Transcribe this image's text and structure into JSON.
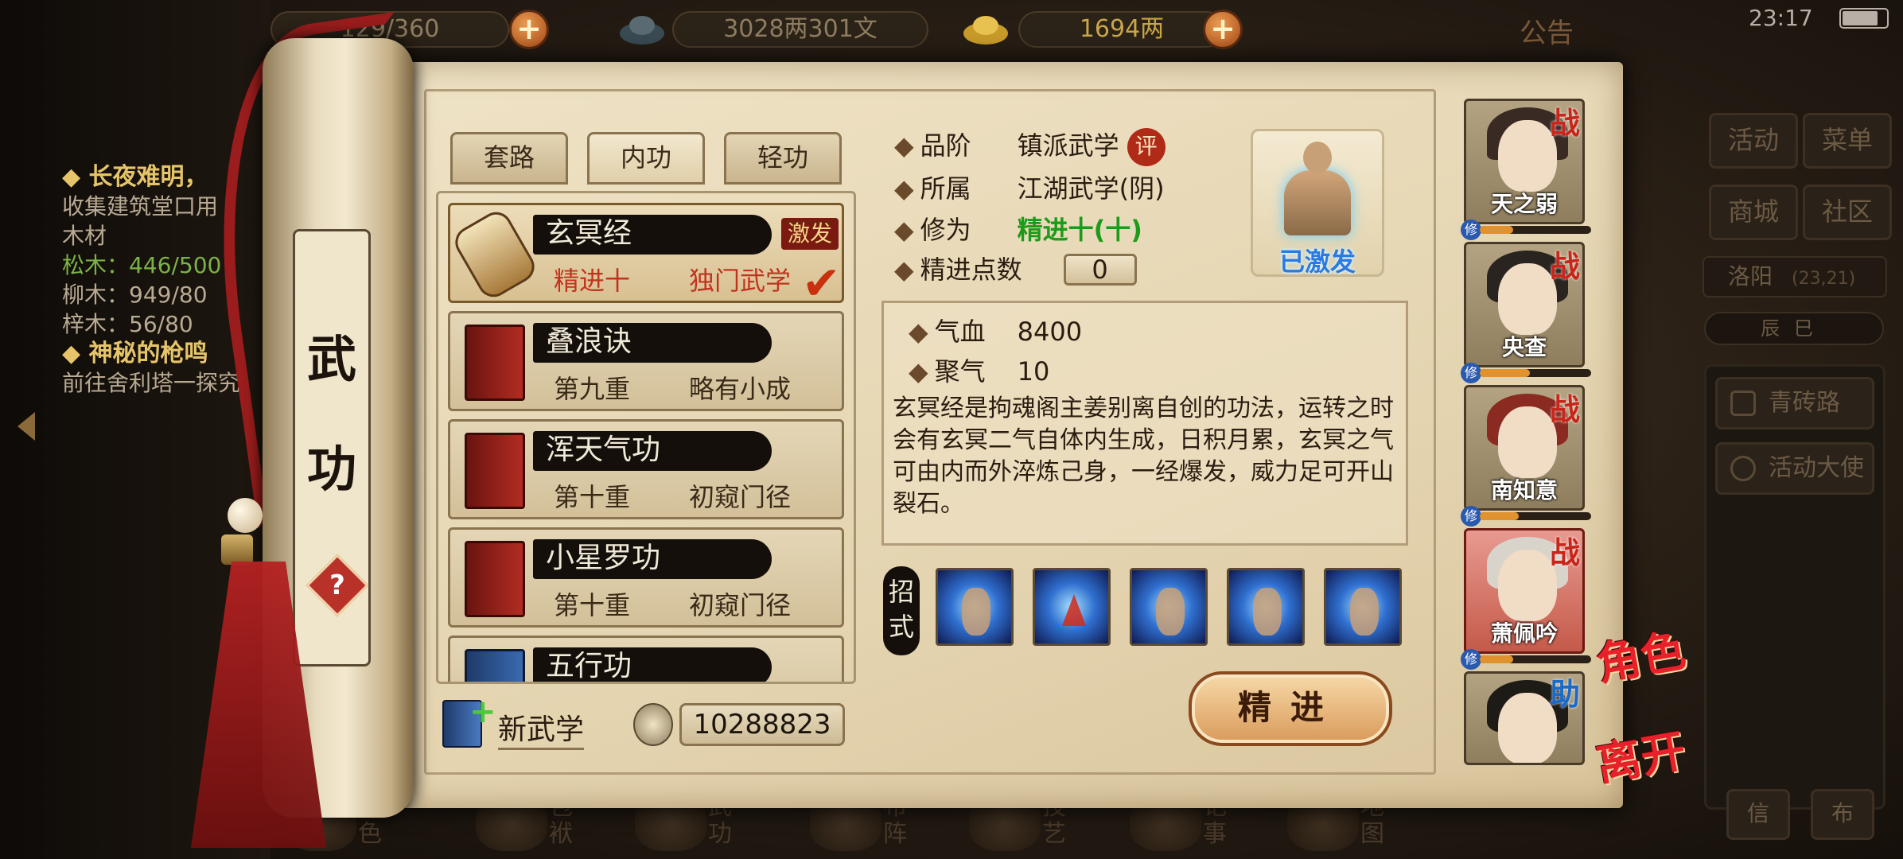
{
  "topbar": {
    "stamina": "129/360",
    "copper": "3028两301文",
    "gold": "1694两",
    "notice": "公告",
    "time": "23:17"
  },
  "quest": {
    "q1_title": "◆ 长夜难明，",
    "q1_desc": "收集建筑堂口用",
    "q1_sub": "木材",
    "mat1": "松木：446/500",
    "mat2": "柳木：949/80",
    "mat3": "梓木：56/80",
    "q2_title": "◆ 神秘的枪鸣",
    "q2_desc": "前往舍利塔一探究"
  },
  "right_panel": {
    "activity": "活动",
    "menu": "菜单",
    "shop": "商城",
    "community": "社区",
    "location": "洛阳",
    "coords": "(23,21)",
    "time_dial": "辰巳",
    "road_btn": "青砖路",
    "ambassador_btn": "活动大使",
    "btn_letter": "信",
    "btn_cloth": "布"
  },
  "bottom_nav": [
    {
      "label": "角色",
      "icon": "character-icon"
    },
    {
      "label": "包袱",
      "icon": "bag-icon"
    },
    {
      "label": "武功",
      "icon": "martial-arts-icon"
    },
    {
      "label": "布阵",
      "icon": "formation-icon"
    },
    {
      "label": "技艺",
      "icon": "craft-icon"
    },
    {
      "label": "记事",
      "icon": "journal-icon"
    },
    {
      "label": "地图",
      "icon": "map-icon"
    }
  ],
  "scroll": {
    "title1": "武",
    "title2": "功",
    "help": "?"
  },
  "tabs": {
    "t1": "套路",
    "t2": "内功",
    "t3": "轻功",
    "active": "内功"
  },
  "skills": [
    {
      "name": "玄冥经",
      "level": "精进十",
      "stage": "独门武学",
      "activated": "激发",
      "selected": true
    },
    {
      "name": "叠浪诀",
      "level": "第九重",
      "stage": "略有小成"
    },
    {
      "name": "浑天气功",
      "level": "第十重",
      "stage": "初窥门径"
    },
    {
      "name": "小星罗功",
      "level": "第十重",
      "stage": "初窥门径"
    },
    {
      "name": "五行功",
      "level": "",
      "stage": ""
    }
  ],
  "new_skill": "新武学",
  "points_total": "10288823",
  "detail": {
    "grade_label": "品阶",
    "grade_value": "镇派武学",
    "grade_badge": "评",
    "belong_label": "所属",
    "belong_value": "江湖武学(阴)",
    "cultivation_label": "修为",
    "cultivation_value": "精进十(十)",
    "points_label": "精进点数",
    "points_value": "0",
    "activated_label": "已激发",
    "hp_label": "气血",
    "hp_value": "8400",
    "qi_label": "聚气",
    "qi_value": "10",
    "description": "玄冥经是拘魂阁主姜别离自创的功法，运转之时会有玄冥二气自体内生成，日积月累，玄冥之气可由内而外淬炼己身，一经爆发，威力足可开山裂石。",
    "moves_label": "招式",
    "train_button": "精进"
  },
  "characters": [
    {
      "name": "天之弱",
      "badge": "战",
      "xiu": "修",
      "progress": 0.3
    },
    {
      "name": "央查",
      "badge": "战",
      "xiu": "修",
      "progress": 0.45
    },
    {
      "name": "南知意",
      "badge": "战",
      "xiu": "修",
      "progress": 0.35
    },
    {
      "name": "萧佩吟",
      "badge": "战",
      "xiu": "修",
      "progress": 0.3,
      "selected": true
    },
    {
      "name": "",
      "badge": "助"
    }
  ],
  "side_labels": {
    "role": "角色",
    "leave": "离开"
  }
}
